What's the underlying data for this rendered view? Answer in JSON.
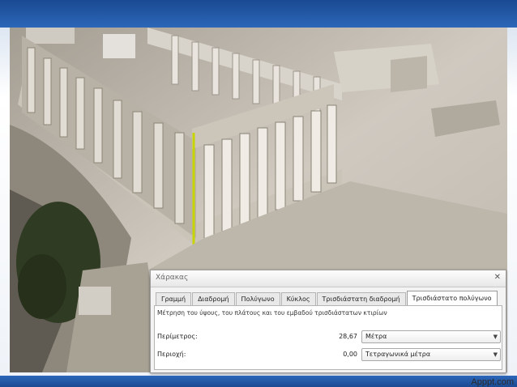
{
  "ruler_window": {
    "title": "Χάρακας",
    "tabs": [
      {
        "label": "Γραμμή",
        "active": false
      },
      {
        "label": "Διαδρομή",
        "active": false
      },
      {
        "label": "Πολύγωνο",
        "active": false
      },
      {
        "label": "Κύκλος",
        "active": false
      },
      {
        "label": "Τρισδιάστατη διαδρομή",
        "active": false
      },
      {
        "label": "Τρισδιάστατο πολύγωνο",
        "active": true
      }
    ],
    "description": "Μέτρηση του ύψους, του πλάτους και του εμβαδού τρισδιάστατων κτιρίων",
    "perimeter": {
      "label": "Περίμετρος:",
      "value": "28,67",
      "unit": "Μέτρα"
    },
    "area": {
      "label": "Περιοχή:",
      "value": "0,00",
      "unit": "Τετραγωνικά μέτρα"
    }
  },
  "watermark": "Apppt.com",
  "colors": {
    "slide_blue": "#2257a8",
    "measure_line": "#c8d400"
  },
  "icons": {
    "close": "close-icon",
    "dropdown": "chevron-down-icon"
  }
}
